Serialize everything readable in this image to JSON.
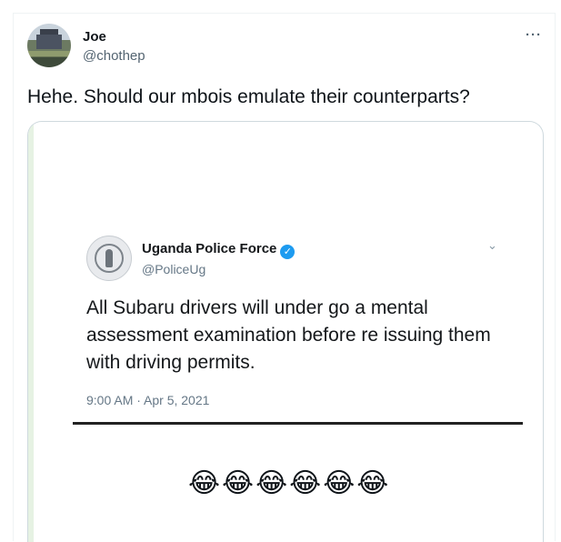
{
  "tweet": {
    "author_name": "Joe",
    "author_handle": "@chothep",
    "more_icon": "···",
    "text": "Hehe. Should our mbois emulate their counterparts?"
  },
  "embedded_image": {
    "account_name": "Uganda Police Force",
    "verified_mark": "✓",
    "account_handle": "@PoliceUg",
    "chevron": "⌄",
    "text": "All Subaru drivers will under go a mental assessment examination before re issuing them with driving permits.",
    "timestamp": "9:00 AM · Apr 5, 2021",
    "emojis": "😂😂😂😂😂😂"
  },
  "colors": {
    "accent": "#1d9bf0",
    "secondary_text": "#536471"
  }
}
